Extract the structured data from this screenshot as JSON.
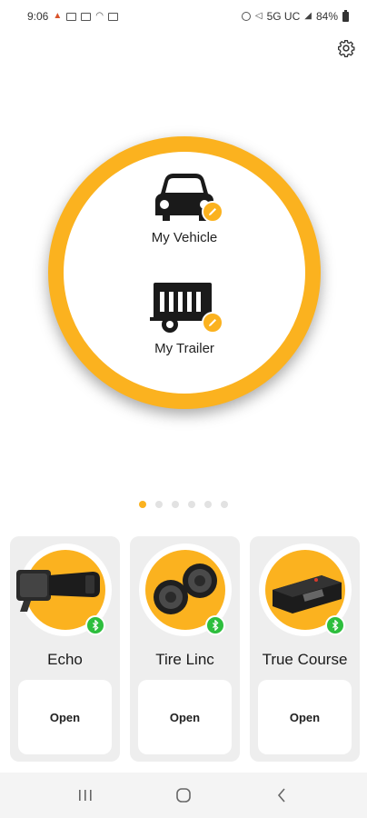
{
  "status_bar": {
    "time": "9:06",
    "network": "5G UC",
    "battery": "84%"
  },
  "header": {
    "settings_icon": "gear-icon"
  },
  "hub": {
    "vehicle_label": "My Vehicle",
    "trailer_label": "My Trailer",
    "accent_color": "#FBB21F"
  },
  "pagination": {
    "total": 6,
    "active": 0
  },
  "products": [
    {
      "title": "Echo",
      "open_label": "Open",
      "status_icon": "bluetooth-icon"
    },
    {
      "title": "Tire Linc",
      "open_label": "Open",
      "status_icon": "bluetooth-icon"
    },
    {
      "title": "True Course",
      "open_label": "Open",
      "status_icon": "bluetooth-icon"
    }
  ],
  "nav": {
    "recents": "recents-icon",
    "home": "home-icon",
    "back": "back-icon"
  }
}
